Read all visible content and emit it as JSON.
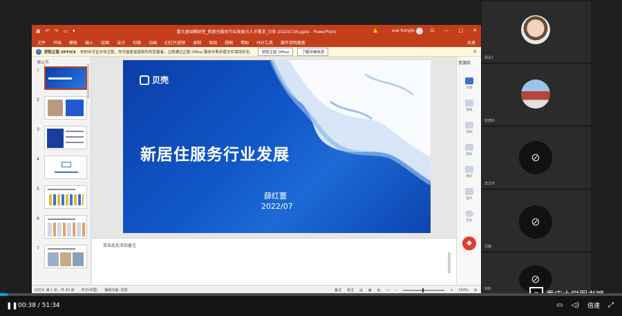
{
  "ppt": {
    "window_title": "重大虚拟教研室_新居住服务行业发展与人才需求_贝壳 20220726.pptx  -  PowerPoint",
    "user_name": "xue hongle",
    "menu": [
      "文件",
      "开始",
      "模板",
      "插入",
      "绘图",
      "设计",
      "切换",
      "动画",
      "幻灯片放映",
      "录制",
      "审阅",
      "视图",
      "帮助",
      "PDF工具",
      "操作说明搜索"
    ],
    "share_label": "共享",
    "notice": {
      "title": "获取正版 OFFICE",
      "text": "你的许可证并非正版，你可能是盗版软件的受害者。立即通过正版 Office 服务中断并使文件保持安全。",
      "btn_get": "获取正版 Office",
      "btn_more": "了解详细信息"
    },
    "section_name": "默认节",
    "thumbnails": [
      {
        "num": "1",
        "active": true
      },
      {
        "num": "2",
        "active": false
      },
      {
        "num": "3",
        "active": false
      },
      {
        "num": "4",
        "active": false
      },
      {
        "num": "5",
        "active": false
      },
      {
        "num": "6",
        "active": false
      },
      {
        "num": "7",
        "active": false
      }
    ],
    "slide": {
      "logo_text": "贝壳",
      "title": "新居住服务行业发展",
      "author": "薛红蕾",
      "date": "2022/07"
    },
    "notes_placeholder": "单击此处添加备注",
    "resources": {
      "title": "资源库",
      "items": [
        "资源",
        "图库",
        "视频",
        "图标",
        "图形",
        "图示",
        "更多"
      ]
    },
    "status": {
      "slide_count": "幻灯片 第 1 张，共 40 张",
      "language": "中文(中国)",
      "accessibility": "辅助功能: 调查",
      "notes": "备注",
      "comments": "批注",
      "zoom": "104%"
    }
  },
  "participants": [
    {
      "name": "靠近1",
      "type": "child-avatar"
    },
    {
      "name": "曾德利",
      "type": "building-avatar"
    },
    {
      "name": "李文杰",
      "type": "camera-off"
    },
    {
      "name": "吕都",
      "type": "camera-off"
    },
    {
      "name": "阿秋",
      "type": "camera-off"
    }
  ],
  "player": {
    "current_time": "00:38",
    "total_time": "51:34",
    "progress": 0.0123,
    "speed_label": "倍速",
    "watermark": "重庆大学图书馆"
  }
}
